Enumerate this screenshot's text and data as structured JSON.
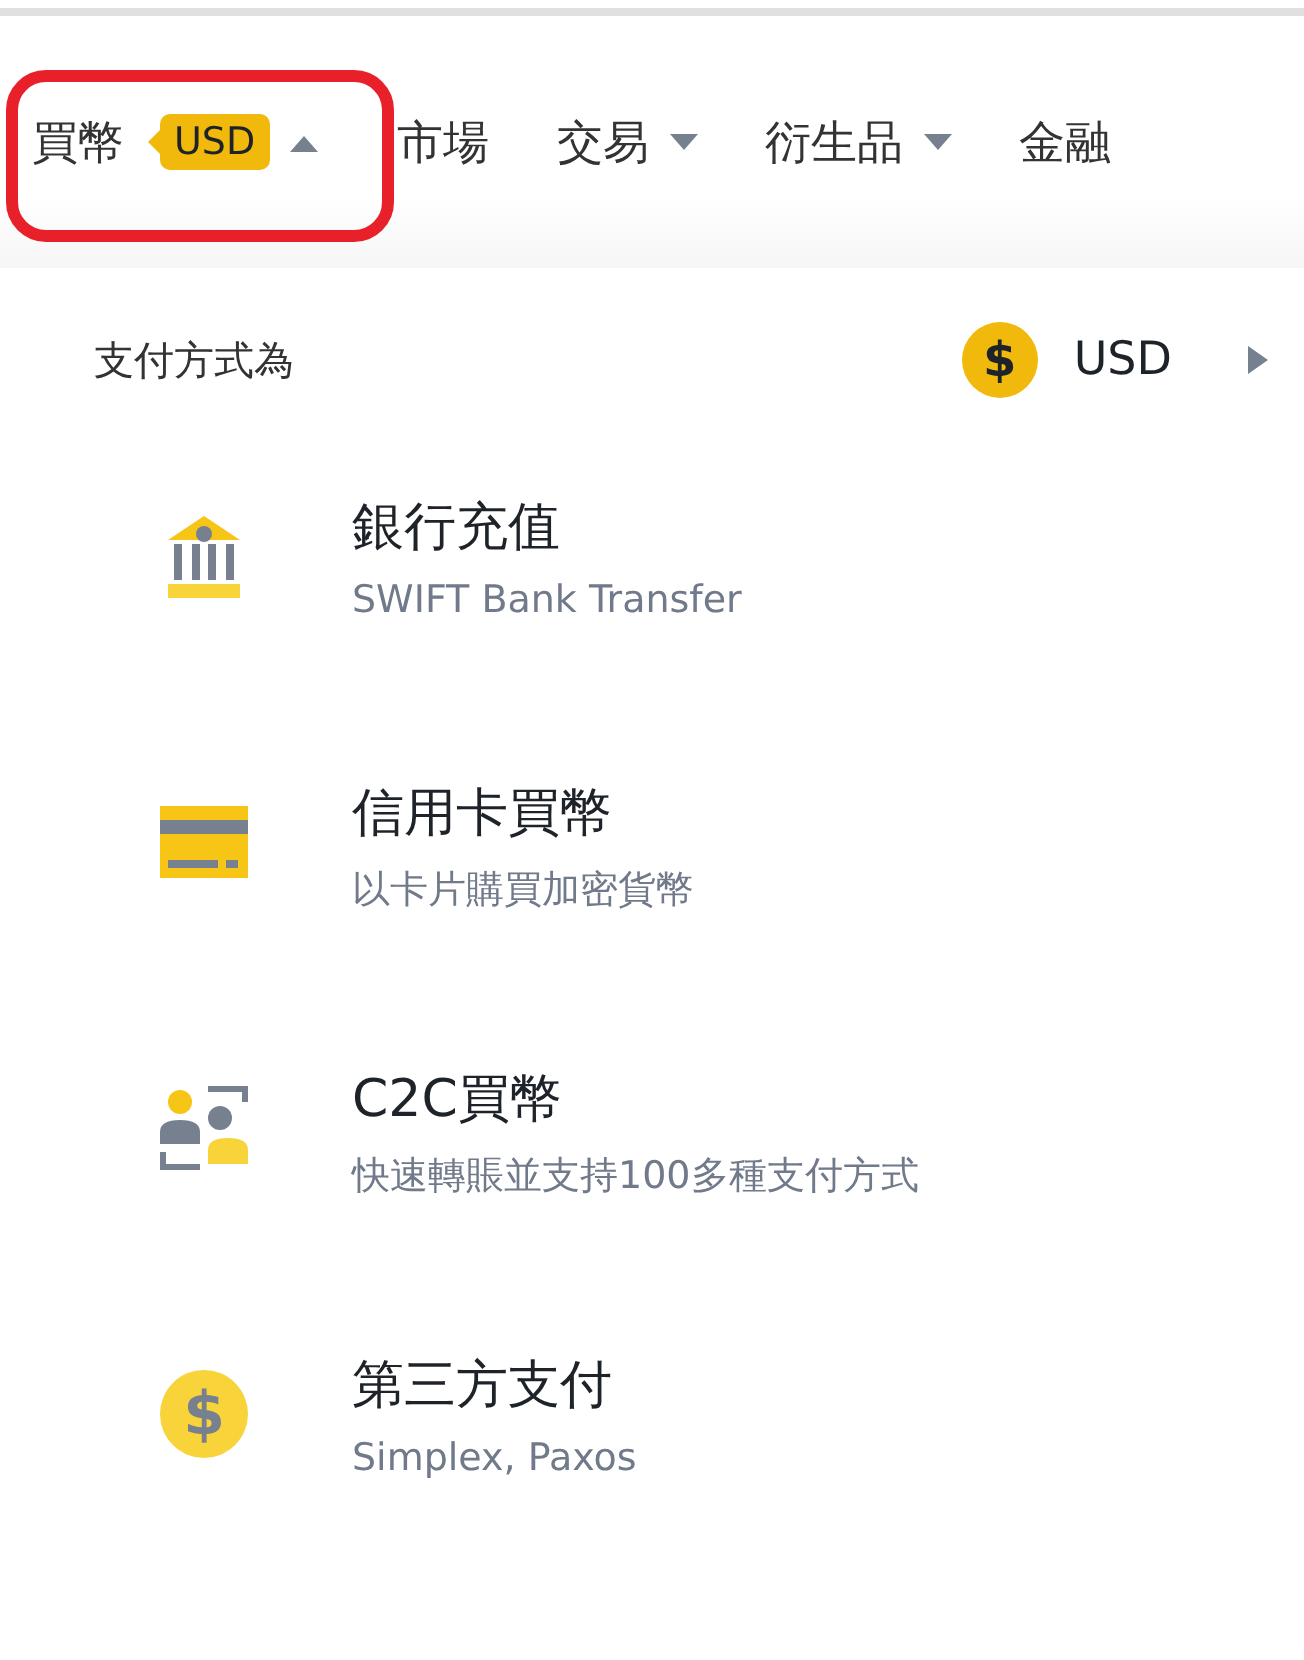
{
  "nav": {
    "items": [
      {
        "label": "買幣",
        "kind": "menu",
        "badge": "USD",
        "expanded": true,
        "highlighted": true
      },
      {
        "label": "市場",
        "kind": "link"
      },
      {
        "label": "交易",
        "kind": "menu",
        "expanded": false
      },
      {
        "label": "衍生品",
        "kind": "menu",
        "expanded": false
      },
      {
        "label": "金融",
        "kind": "link"
      }
    ]
  },
  "dropdown": {
    "payment_label": "支付方式為",
    "currency": {
      "symbol": "$",
      "code": "USD"
    },
    "methods": [
      {
        "kind": "bank",
        "title": "銀行充值",
        "subtitle": "SWIFT Bank Transfer"
      },
      {
        "kind": "card",
        "title": "信用卡買幣",
        "subtitle": "以卡片購買加密貨幣"
      },
      {
        "kind": "c2c",
        "title": "C2C買幣",
        "subtitle": "快速轉賬並支持100多種支付方式"
      },
      {
        "kind": "coin",
        "symbol": "$",
        "title": "第三方支付",
        "subtitle": "Simplex, Paxos"
      }
    ]
  }
}
